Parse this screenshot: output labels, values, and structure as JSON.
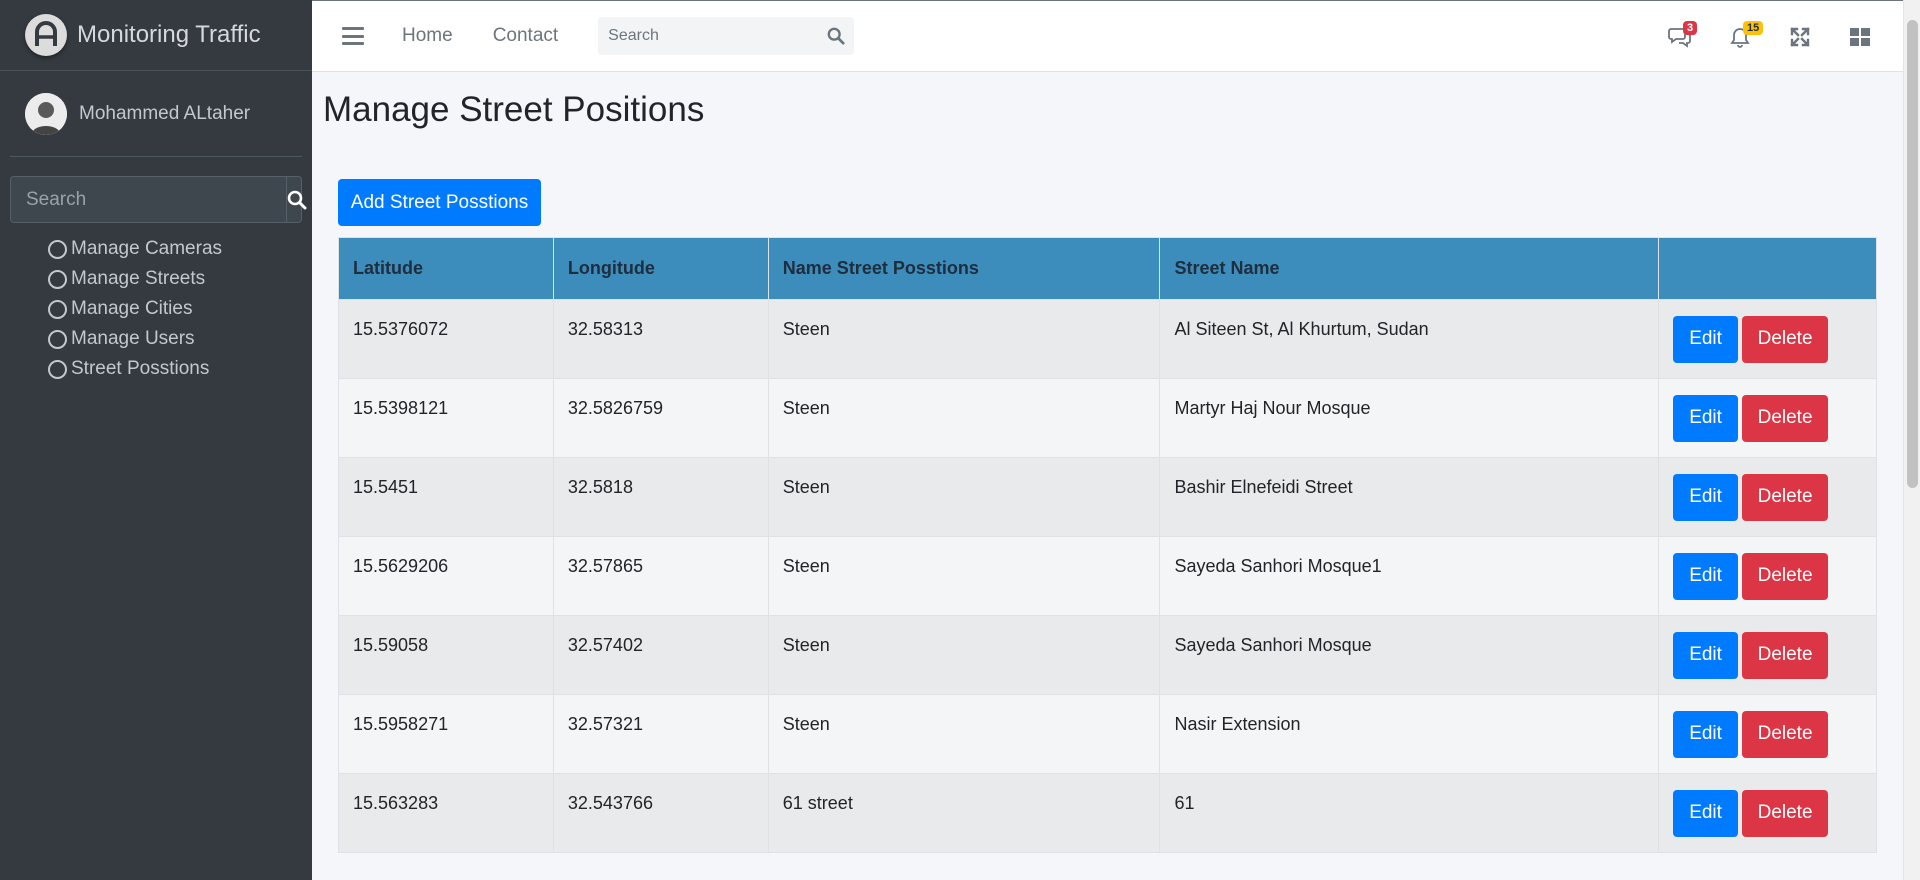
{
  "brand": {
    "title": "Monitoring Traffic"
  },
  "user": {
    "name": "Mohammed ALtaher"
  },
  "sidebar": {
    "search_placeholder": "Search",
    "items": [
      {
        "label": "Manage Cameras"
      },
      {
        "label": "Manage Streets"
      },
      {
        "label": "Manage Cities"
      },
      {
        "label": "Manage Users"
      },
      {
        "label": "Street Posstions"
      }
    ]
  },
  "navbar": {
    "links": [
      "Home",
      "Contact"
    ],
    "search_placeholder": "Search",
    "messages_count": "3",
    "notifications_count": "15"
  },
  "page": {
    "title": "Manage Street Positions",
    "add_button": "Add Street Posstions"
  },
  "table": {
    "headers": [
      "Latitude",
      "Longitude",
      "Name Street Posstions",
      "Street Name",
      ""
    ],
    "edit_label": "Edit",
    "delete_label": "Delete",
    "rows": [
      [
        "15.5376072",
        "32.58313",
        "Steen",
        "Al Siteen St, Al Khurtum, Sudan"
      ],
      [
        "15.5398121",
        "32.5826759",
        "Steen",
        "Martyr Haj Nour Mosque"
      ],
      [
        "15.5451",
        "32.5818",
        "Steen",
        "Bashir Elnefeidi Street"
      ],
      [
        "15.5629206",
        "32.57865",
        "Steen",
        "Sayeda Sanhori Mosque1"
      ],
      [
        "15.59058",
        "32.57402",
        "Steen",
        "Sayeda Sanhori Mosque"
      ],
      [
        "15.5958271",
        "32.57321",
        "Steen",
        "Nasir Extension"
      ],
      [
        "15.563283",
        "32.543766",
        "61 street",
        "61"
      ]
    ]
  },
  "colors": {
    "sidebar_bg": "#343a40",
    "table_header": "#3c8dbc",
    "primary": "#007bff",
    "danger": "#dc3545"
  }
}
